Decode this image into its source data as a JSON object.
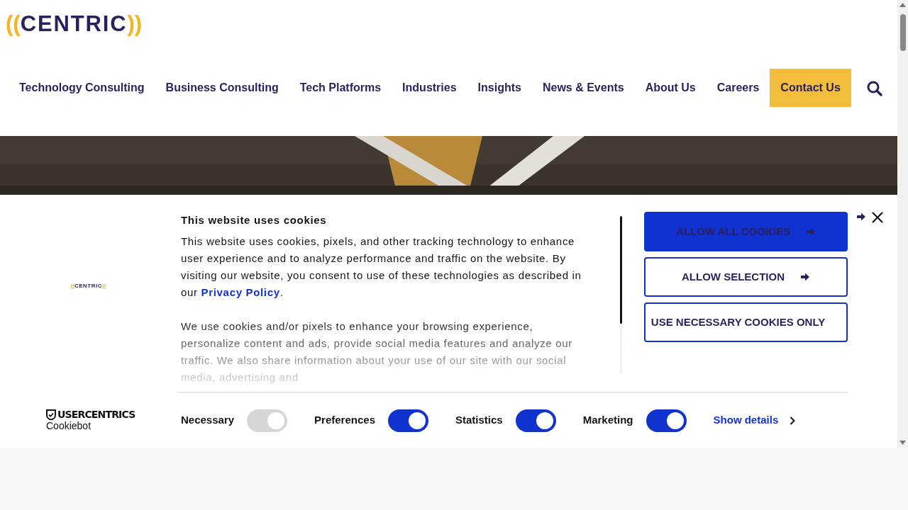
{
  "header": {
    "logo": {
      "left": "((",
      "word": "CENTRIC",
      "right": "))"
    },
    "nav": [
      {
        "label": "Technology Consulting",
        "kind": "link"
      },
      {
        "label": "Business Consulting",
        "kind": "link"
      },
      {
        "label": "Tech Platforms",
        "kind": "link"
      },
      {
        "label": "Industries",
        "kind": "link"
      },
      {
        "label": "Insights",
        "kind": "link"
      },
      {
        "label": "News & Events",
        "kind": "link"
      },
      {
        "label": "About Us",
        "kind": "link"
      },
      {
        "label": "Careers",
        "kind": "link"
      },
      {
        "label": "Contact Us",
        "kind": "cta"
      }
    ]
  },
  "cookie_banner": {
    "logo": {
      "left": "((",
      "word": "CENTRIC",
      "right": "))"
    },
    "provider": {
      "brand": "USERCENTRICS",
      "product": "Cookiebot"
    },
    "title": "This website uses cookies",
    "paragraphs": [
      {
        "text": "This website uses cookies, pixels, and other tracking technology to enhance user experience and to analyze performance and traffic on the website. By visiting our website, you consent to use of these technologies as described in our ",
        "link": "Privacy Policy",
        "after": "."
      },
      {
        "text": "We use cookies and/or pixels to enhance your browsing experience, personalize content and ads, provide social media features and analyze our traffic. We also share information about your use of our site with our social media, advertising and"
      }
    ],
    "buttons": [
      {
        "label": "ALLOW ALL COOKIES",
        "kind": "filled"
      },
      {
        "label": "ALLOW SELECTION",
        "kind": "outline"
      },
      {
        "label": "USE NECESSARY COOKIES ONLY",
        "kind": "outline"
      }
    ],
    "toggles": [
      {
        "label": "Necessary",
        "on": true,
        "disabled": true
      },
      {
        "label": "Preferences",
        "on": true,
        "disabled": false
      },
      {
        "label": "Statistics",
        "on": true,
        "disabled": false
      },
      {
        "label": "Marketing",
        "on": true,
        "disabled": false
      }
    ],
    "details_link": "Show details"
  }
}
